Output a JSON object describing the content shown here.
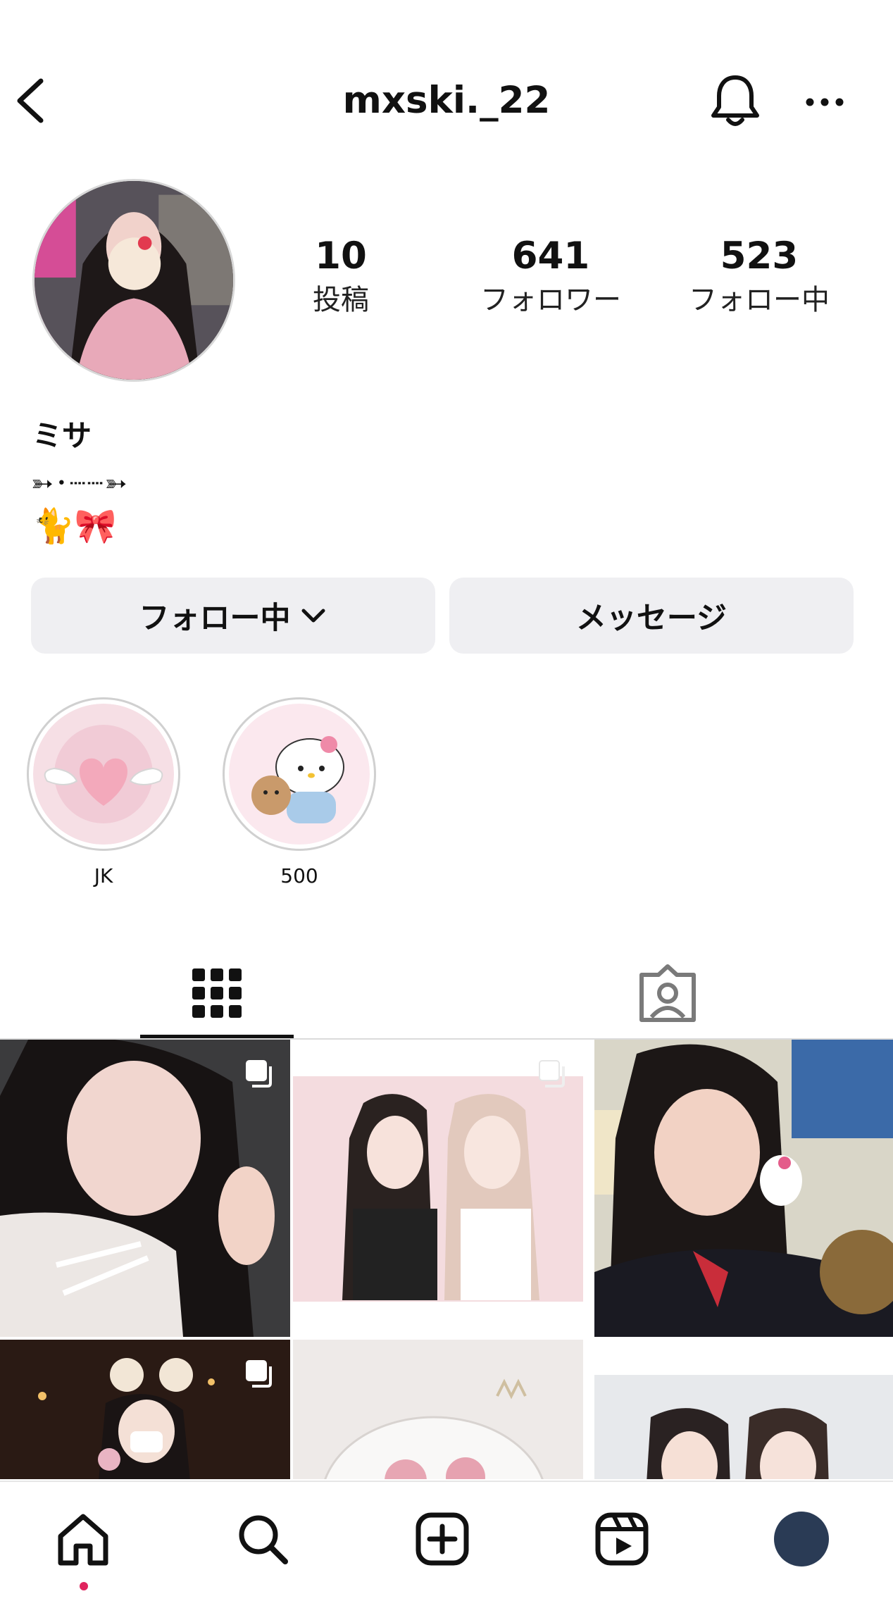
{
  "header": {
    "username": "mxski._22",
    "icons": {
      "back": "chevron-left-icon",
      "notifications": "bell-icon",
      "more": "ellipsis-icon"
    }
  },
  "profile": {
    "stats": [
      {
        "value": "10",
        "label": "投稿"
      },
      {
        "value": "641",
        "label": "フォロワー"
      },
      {
        "value": "523",
        "label": "フォロー中"
      }
    ],
    "name": "ミサ",
    "bio_line1": "➳･┈┈➳",
    "bio_line2": "🐈🎀"
  },
  "actions": {
    "following_label": "フォロー中",
    "message_label": "メッセージ"
  },
  "highlights": [
    {
      "label": "JK"
    },
    {
      "label": "500"
    }
  ],
  "tabs": {
    "active": "grid",
    "items": [
      {
        "icon": "grid-icon"
      },
      {
        "icon": "tagged-user-icon"
      }
    ]
  },
  "grid_posts": [
    {
      "multi": true
    },
    {
      "multi": true
    },
    {
      "multi": false
    },
    {
      "multi": true
    },
    {
      "multi": false
    },
    {
      "multi": false
    }
  ],
  "bottom_nav": {
    "items": [
      "home-icon",
      "search-icon",
      "create-icon",
      "reels-icon",
      "profile-avatar"
    ],
    "active": "home",
    "colors": {
      "notification_dot": "#e0245e",
      "avatar": "#2a3b55"
    }
  }
}
